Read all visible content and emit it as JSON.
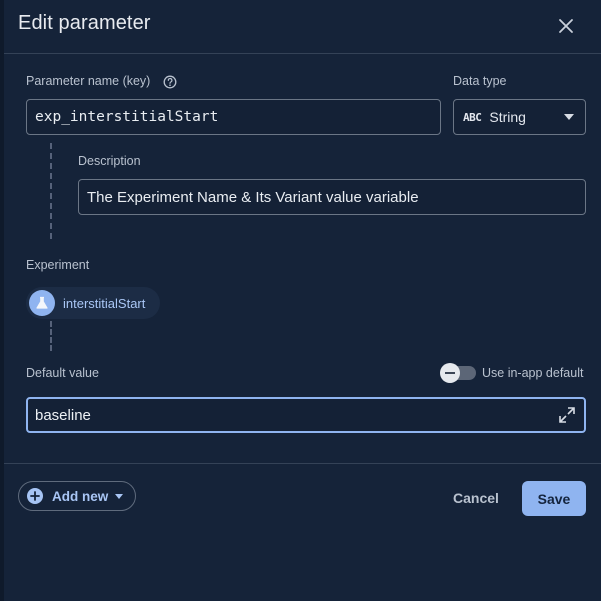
{
  "dialog": {
    "title": "Edit parameter"
  },
  "parameter": {
    "name_label": "Parameter name (key)",
    "name_value": "exp_interstitialStart",
    "data_type_label": "Data type",
    "data_type_value": "String",
    "data_type_icon": "ABC"
  },
  "description": {
    "label": "Description",
    "value": "The Experiment Name & Its Variant value variable"
  },
  "experiment": {
    "label": "Experiment",
    "chip_label": "interstitialStart"
  },
  "default_value": {
    "label": "Default value",
    "toggle_label": "Use in-app default",
    "value": "baseline"
  },
  "footer": {
    "add_new_label": "Add new",
    "cancel_label": "Cancel",
    "save_label": "Save"
  },
  "colors": {
    "background": "#152339",
    "accent": "#8fb4f0",
    "border": "#6b7686"
  }
}
